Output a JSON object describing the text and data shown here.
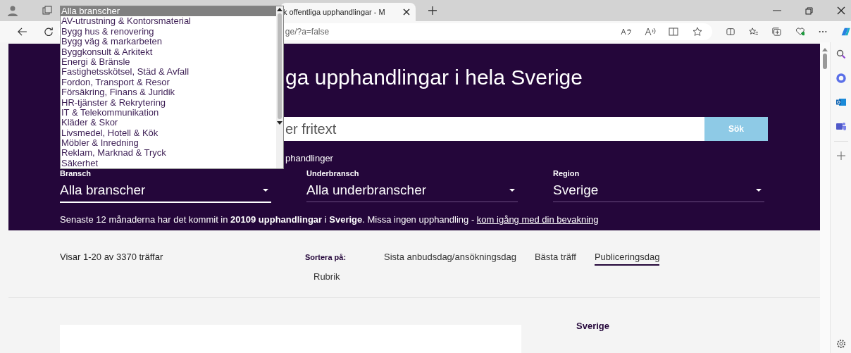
{
  "browser": {
    "tab_title": "k offentliga upphandlingar - M",
    "url": "ge/?a=false"
  },
  "hero": {
    "title": "ga upphandlingar i hela Sverige",
    "search": {
      "placeholder": "er fritext"
    },
    "search_button": "Sök",
    "note": "phandlinger",
    "filters": [
      {
        "label": "Bransch",
        "value": "Alla branscher",
        "selected": true
      },
      {
        "label": "Underbransch",
        "value": "Alla underbranscher",
        "selected": false
      },
      {
        "label": "Region",
        "value": "Sverige",
        "selected": false
      }
    ],
    "summary": "Senaste 12 månaderna har det kommit in **20109 upphandlingar** i **Sverige**. Missa ingen upphandling - ",
    "summary_link": "kom igång med din bevakning"
  },
  "results": {
    "count": "Visar 1-20 av 3370 träffar",
    "sort_label": "Sortera på:",
    "sort_options": [
      {
        "label": "Sista anbudsdag/ansökningsdag",
        "selected": false
      },
      {
        "label": "Bästa träff",
        "selected": false
      },
      {
        "label": "Publiceringsdag",
        "selected": true
      },
      {
        "label": "Rubrik",
        "selected": false
      }
    ],
    "side_heading": "Sverige"
  },
  "dropdown": {
    "options": [
      {
        "label": "Alla branscher",
        "selected": true
      },
      {
        "label": "AV-utrustning & Kontorsmaterial",
        "selected": false
      },
      {
        "label": "Bygg hus & renovering",
        "selected": false
      },
      {
        "label": "Bygg väg & markarbeten",
        "selected": false
      },
      {
        "label": "Byggkonsult & Arkitekt",
        "selected": false
      },
      {
        "label": "Energi & Bränsle",
        "selected": false
      },
      {
        "label": "Fastighetsskötsel, Städ & Avfall",
        "selected": false
      },
      {
        "label": "Fordon, Transport & Resor",
        "selected": false
      },
      {
        "label": "Försäkring, Finans & Juridik",
        "selected": false
      },
      {
        "label": "HR-tjänster & Rekrytering",
        "selected": false
      },
      {
        "label": "IT & Telekommunikation",
        "selected": false
      },
      {
        "label": "Kläder & Skor",
        "selected": false
      },
      {
        "label": "Livsmedel, Hotell & Kök",
        "selected": false
      },
      {
        "label": "Möbler & Inredning",
        "selected": false
      },
      {
        "label": "Reklam, Marknad & Tryck",
        "selected": false
      },
      {
        "label": "Säkerhet",
        "selected": false
      }
    ]
  }
}
